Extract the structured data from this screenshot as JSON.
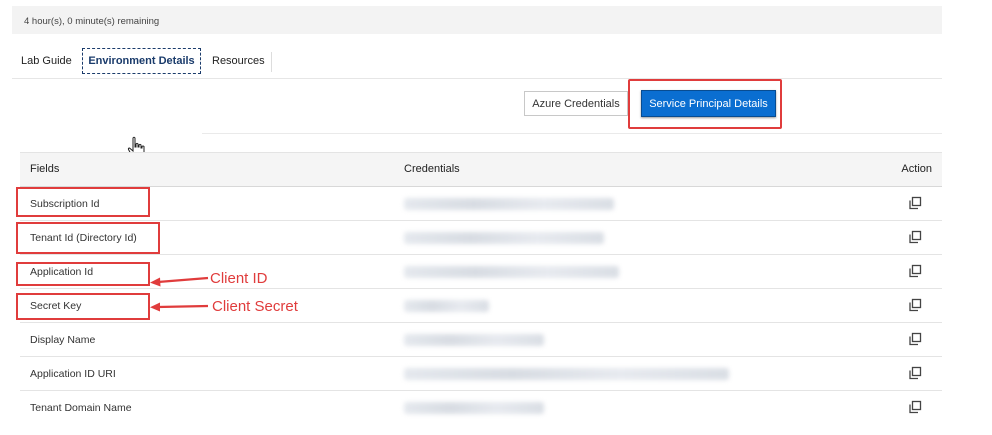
{
  "timer": {
    "text": "4 hour(s), 0 minute(s) remaining"
  },
  "tabs": [
    {
      "label": "Lab Guide"
    },
    {
      "label": "Environment Details"
    },
    {
      "label": "Resources"
    }
  ],
  "toolbar": {
    "azure_label": "Azure Credentials",
    "sp_label": "Service Principal Details"
  },
  "table": {
    "headers": {
      "fields": "Fields",
      "credentials": "Credentials",
      "action": "Action"
    },
    "rows": [
      {
        "field": "Subscription Id"
      },
      {
        "field": "Tenant Id (Directory Id)"
      },
      {
        "field": "Application Id"
      },
      {
        "field": "Secret Key"
      },
      {
        "field": "Display Name"
      },
      {
        "field": "Application ID URI"
      },
      {
        "field": "Tenant Domain Name"
      }
    ]
  },
  "annotations": {
    "client_id": "Client ID",
    "client_secret": "Client Secret"
  },
  "colors": {
    "accent": "#0a6ed1",
    "highlight": "#e03c3c"
  },
  "icons": {
    "copy": "copy-icon",
    "cursor": "hand-pointer-icon"
  }
}
